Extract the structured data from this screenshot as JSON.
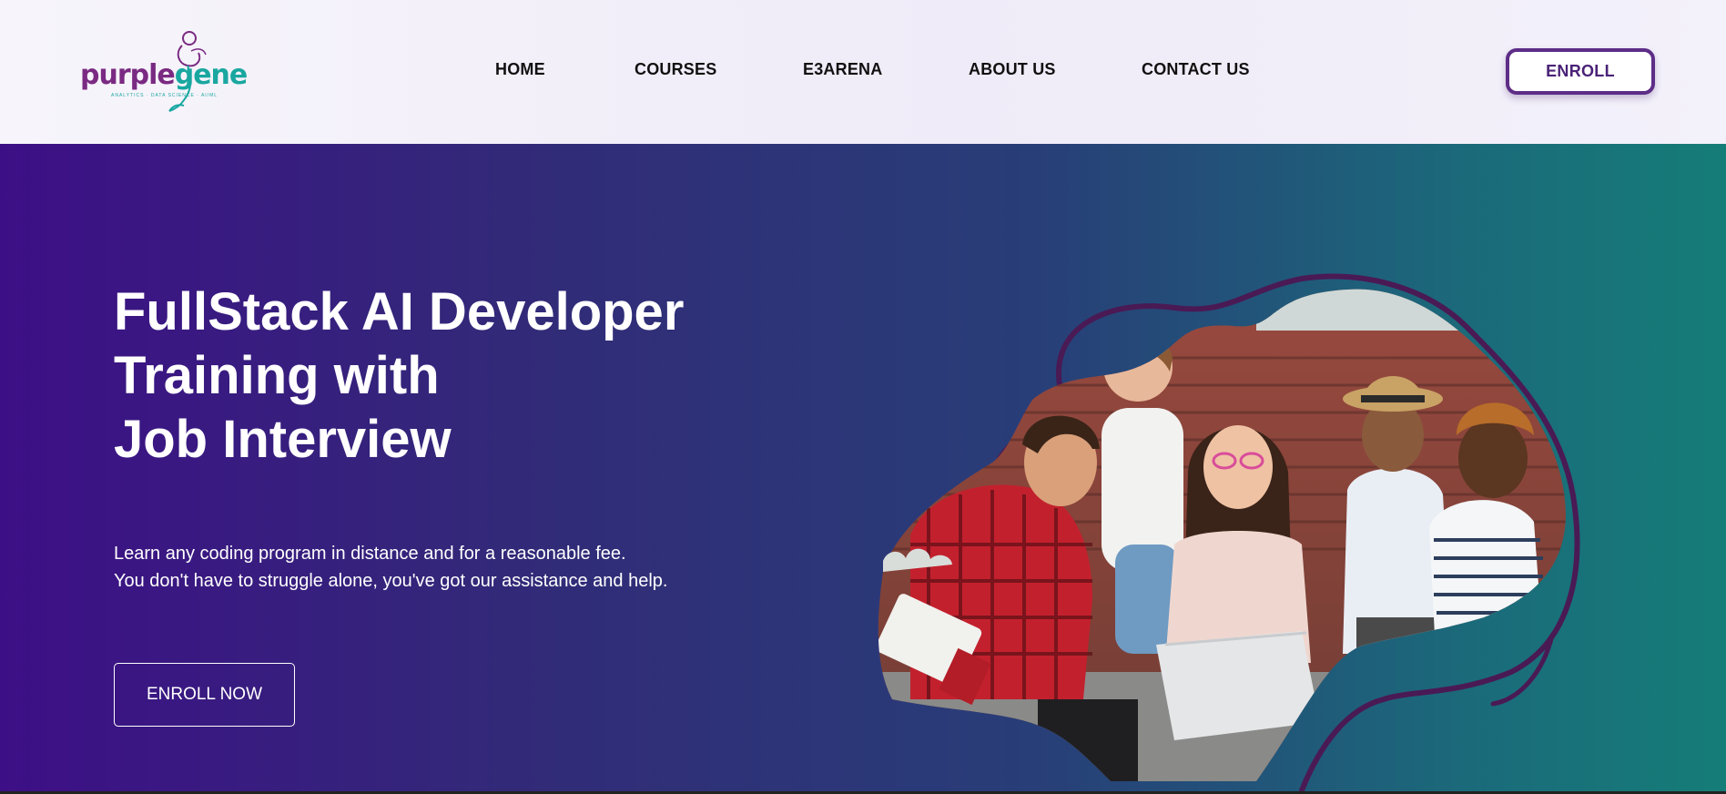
{
  "brand": {
    "logo_part1": "purple",
    "logo_part2": "gene",
    "tagline": "ANALYTICS · DATA SCIENCE · AI/ML",
    "colors": {
      "purple": "#7a2a82",
      "teal": "#19a7a0"
    }
  },
  "nav": {
    "items": [
      {
        "label": "HOME"
      },
      {
        "label": "COURSES"
      },
      {
        "label": "E3ARENA"
      },
      {
        "label": "ABOUT US"
      },
      {
        "label": "CONTACT US"
      }
    ],
    "enroll_label": "ENROLL"
  },
  "hero": {
    "title_lines": [
      "FullStack AI Developer",
      "Training with",
      "Job Interview"
    ],
    "subtitle_lines": [
      "Learn any coding program in distance and for a reasonable fee.",
      "You don't have to struggle alone, you've got our assistance and help."
    ],
    "cta_label": "ENROLL NOW",
    "image": "students-with-laptop-photo",
    "colors": {
      "gradient_start": "#3d0f86",
      "gradient_end": "#157d78",
      "accent_stroke": "#4a1a55"
    }
  }
}
